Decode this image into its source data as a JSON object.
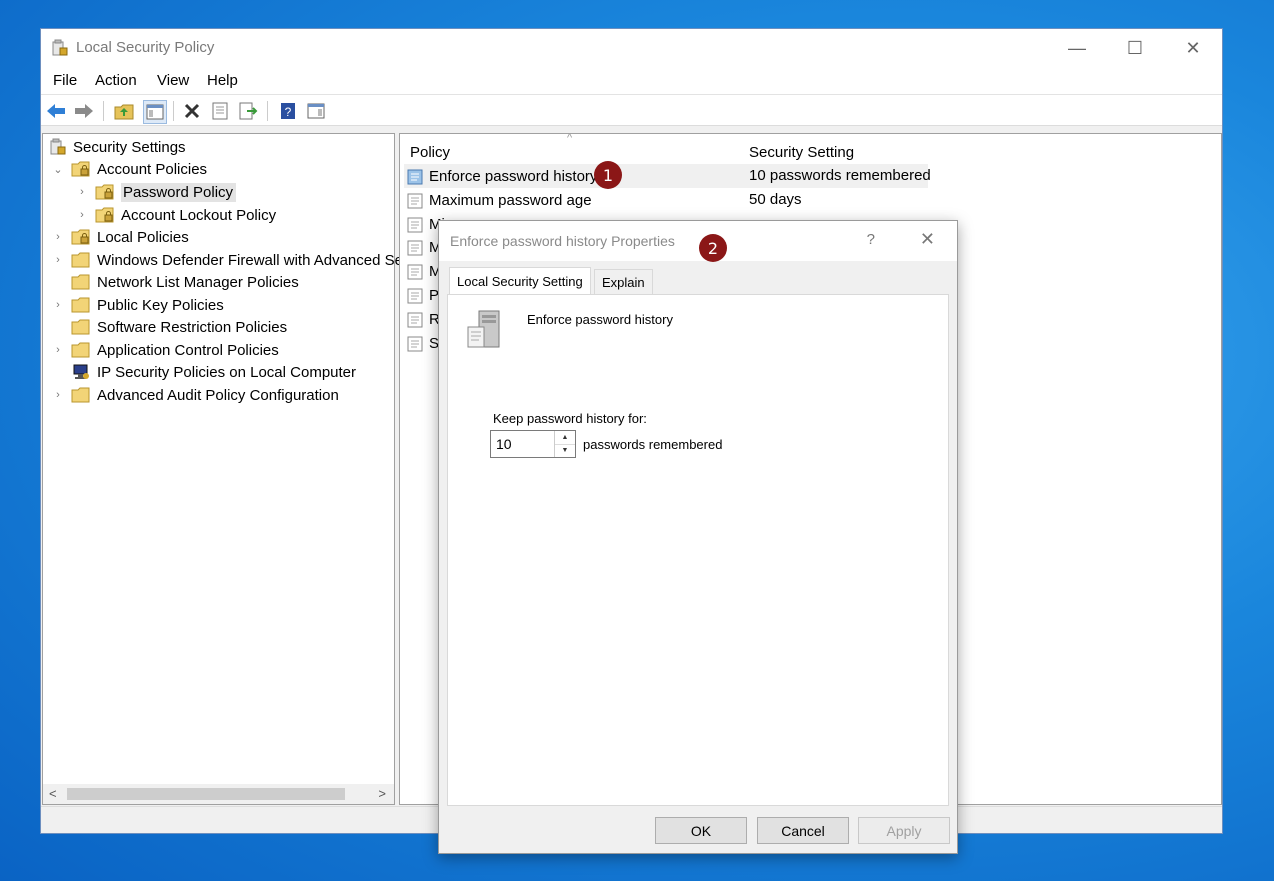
{
  "window": {
    "title": "Local Security Policy",
    "controls": {
      "minimize": "—",
      "maximize": "☐",
      "close": "✕"
    }
  },
  "menu": [
    "File",
    "Action",
    "View",
    "Help"
  ],
  "toolbar": [
    "back-icon",
    "forward-icon",
    "up-folder-icon",
    "show-hide-tree-icon",
    "delete-icon",
    "properties-icon",
    "export-list-icon",
    "help-icon",
    "action-pane-icon"
  ],
  "tree": {
    "root": "Security Settings",
    "items": [
      {
        "label": "Account Policies",
        "expanded": true
      },
      {
        "label": "Password Policy",
        "selected": true
      },
      {
        "label": "Account Lockout Policy"
      },
      {
        "label": "Local Policies"
      },
      {
        "label": "Windows Defender Firewall with Advanced Sec"
      },
      {
        "label": "Network List Manager Policies"
      },
      {
        "label": "Public Key Policies"
      },
      {
        "label": "Software Restriction Policies"
      },
      {
        "label": "Application Control Policies"
      },
      {
        "label": "IP Security Policies on Local Computer"
      },
      {
        "label": "Advanced Audit Policy Configuration"
      }
    ],
    "scroll_left": "<",
    "scroll_right": ">"
  },
  "list": {
    "sort_glyph": "^",
    "columns": [
      "Policy",
      "Security Setting"
    ],
    "rows": [
      {
        "policy": "Enforce password history",
        "setting": "10 passwords remembered"
      },
      {
        "policy": "Maximum password age",
        "setting": "50 days"
      },
      {
        "policy": "Mi",
        "setting": ""
      },
      {
        "policy": "M",
        "setting": ""
      },
      {
        "policy": "M",
        "setting": ""
      },
      {
        "policy": "Pa",
        "setting": ""
      },
      {
        "policy": "Re",
        "setting": ""
      },
      {
        "policy": "St",
        "setting": ""
      }
    ]
  },
  "badges": [
    "1",
    "2"
  ],
  "dialog": {
    "title": "Enforce password history Properties",
    "help": "?",
    "close": "✕",
    "tabs": [
      "Local Security Setting",
      "Explain"
    ],
    "policy_name": "Enforce password history",
    "field_label": "Keep password history for:",
    "value": "10",
    "unit": "passwords remembered",
    "buttons": {
      "ok": "OK",
      "cancel": "Cancel",
      "apply": "Apply"
    }
  }
}
